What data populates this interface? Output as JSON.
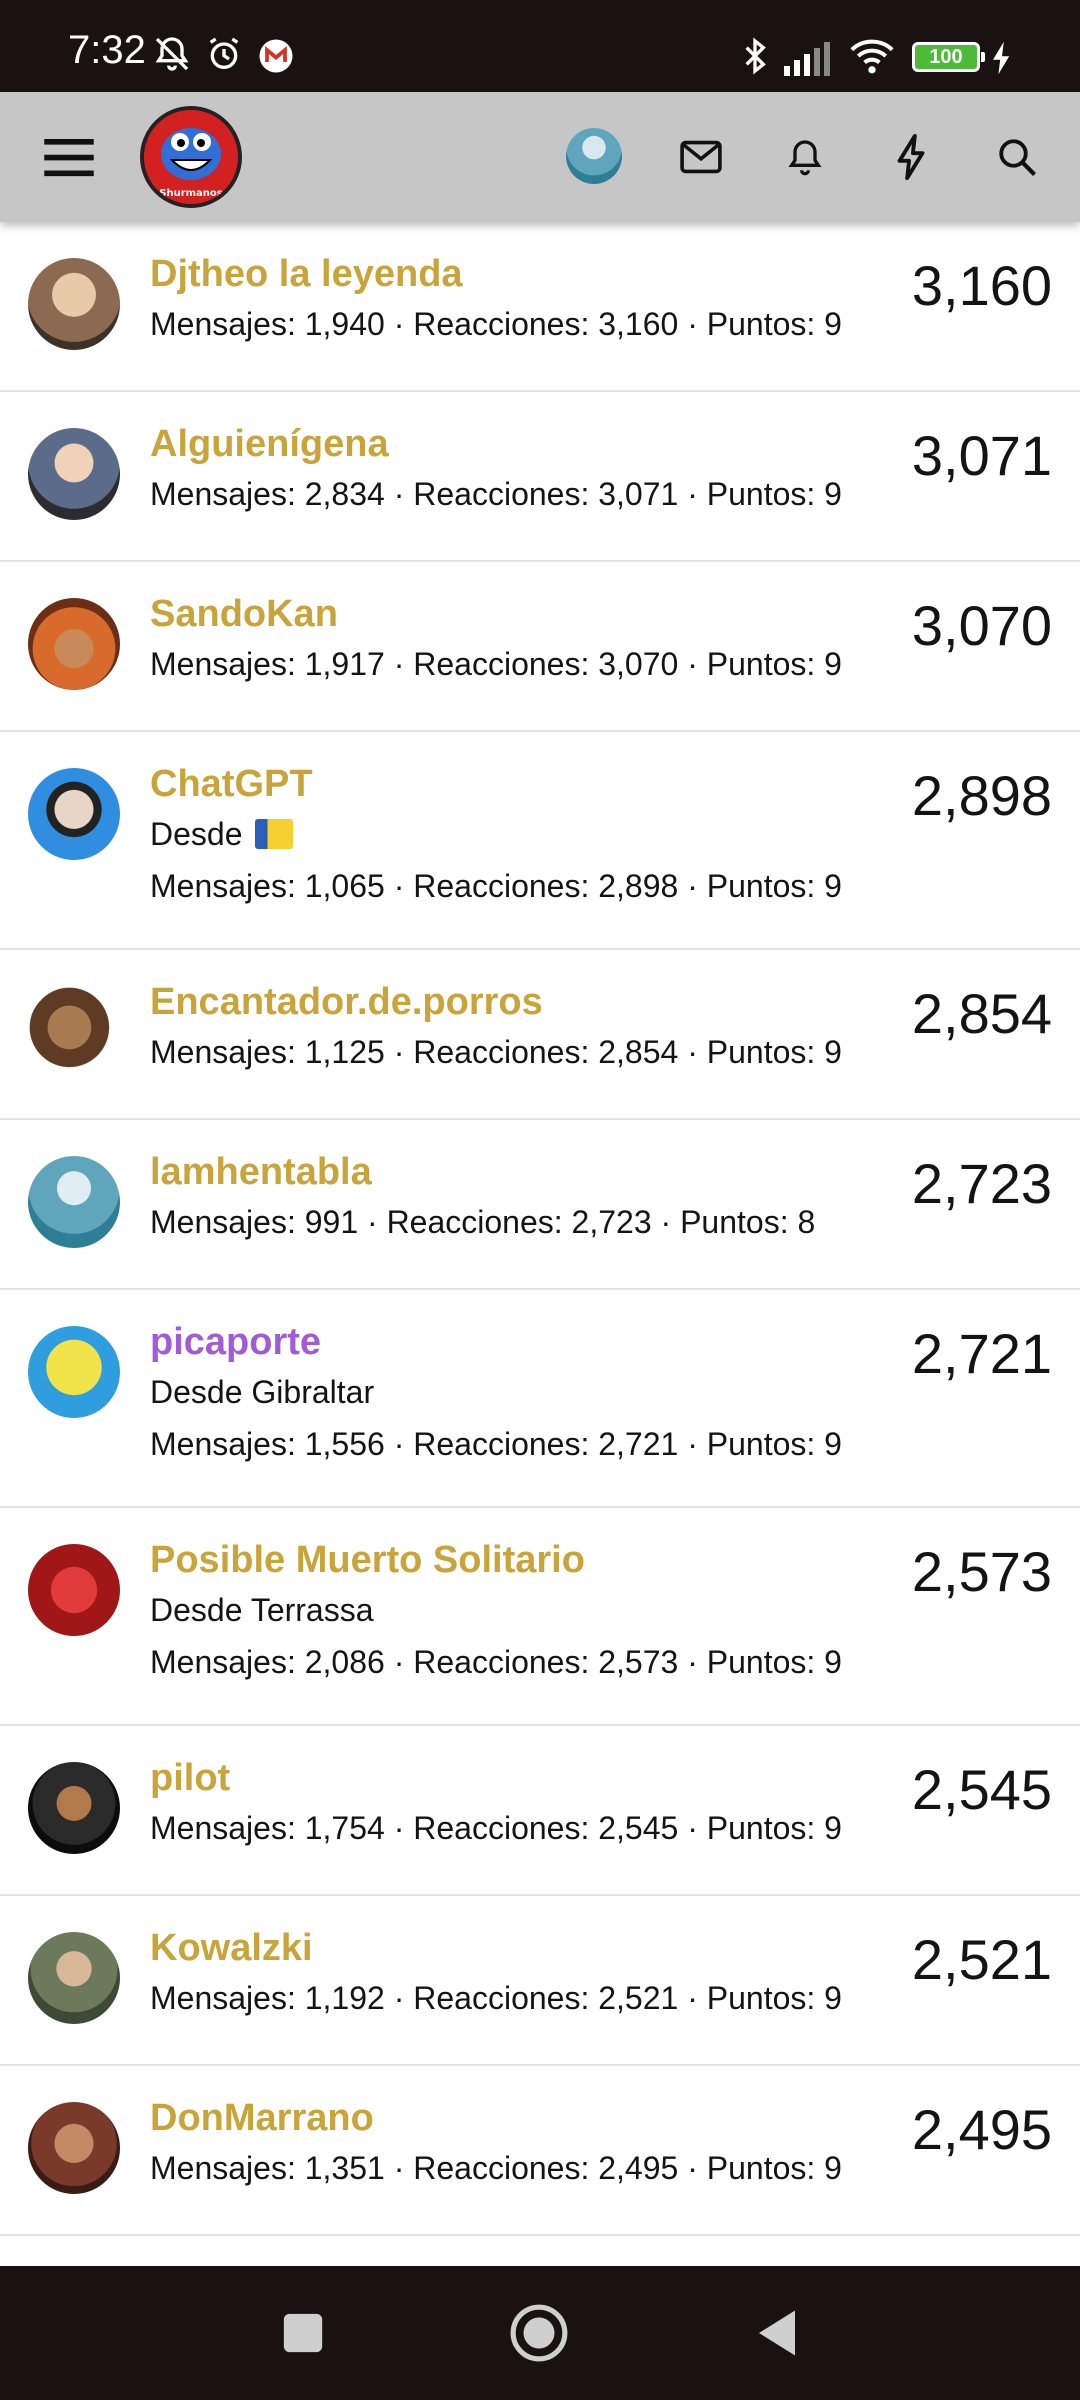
{
  "status_bar": {
    "time": "7:32",
    "battery": "100"
  },
  "header": {
    "logo_text": "Shurmanos"
  },
  "users": [
    {
      "name": "Djtheo la leyenda",
      "location": "",
      "stats": "Mensajes: 1,940 · Reacciones: 3,160 · Puntos: 9",
      "score": "3,160",
      "name_color": "#c9a43a"
    },
    {
      "name": "Alguienígena",
      "location": "",
      "stats": "Mensajes: 2,834 · Reacciones: 3,071 · Puntos: 9",
      "score": "3,071",
      "name_color": "#c9a43a"
    },
    {
      "name": "SandoKan",
      "location": "",
      "stats": "Mensajes: 1,917 · Reacciones: 3,070 · Puntos: 9",
      "score": "3,070",
      "name_color": "#c9a43a"
    },
    {
      "name": "ChatGPT",
      "location": "Desde",
      "stats": "Mensajes: 1,065 · Reacciones: 2,898 · Puntos: 9",
      "score": "2,898",
      "name_color": "#c9a43a"
    },
    {
      "name": "Encantador.de.porros",
      "location": "",
      "stats": "Mensajes: 1,125 · Reacciones: 2,854 · Puntos: 9",
      "score": "2,854",
      "name_color": "#c9a43a"
    },
    {
      "name": "lamhentabla",
      "location": "",
      "stats": "Mensajes: 991 · Reacciones: 2,723 · Puntos: 8",
      "score": "2,723",
      "name_color": "#c9a43a"
    },
    {
      "name": "picaporte",
      "location": "Desde Gibraltar",
      "stats": "Mensajes: 1,556 · Reacciones: 2,721 · Puntos: 9",
      "score": "2,721",
      "name_color": "#a15bd6"
    },
    {
      "name": "Posible Muerto Solitario",
      "location": "Desde Terrassa",
      "stats": "Mensajes: 2,086 · Reacciones: 2,573 · Puntos: 9",
      "score": "2,573",
      "name_color": "#c9a43a"
    },
    {
      "name": "pilot",
      "location": "",
      "stats": "Mensajes: 1,754 · Reacciones: 2,545 · Puntos: 9",
      "score": "2,545",
      "name_color": "#c9a43a"
    },
    {
      "name": "Kowalzki",
      "location": "",
      "stats": "Mensajes: 1,192 · Reacciones: 2,521 · Puntos: 9",
      "score": "2,521",
      "name_color": "#c9a43a"
    },
    {
      "name": "DonMarrano",
      "location": "",
      "stats": "Mensajes: 1,351 · Reacciones: 2,495 · Puntos: 9",
      "score": "2,495",
      "name_color": "#c9a43a"
    }
  ],
  "icons": {
    "menu": "hamburger-menu-icon",
    "mail": "mail-icon",
    "bell": "bell-icon",
    "bolt": "lightning-icon",
    "search": "search-icon",
    "nav_recents": "square-icon",
    "nav_home": "home-circle-icon",
    "nav_back": "back-triangle-icon"
  },
  "colors": {
    "accent_name": "#c9a43a",
    "special_name": "#a15bd6",
    "header_bg": "#c6c6c6",
    "bar_bg": "#1a1212"
  }
}
